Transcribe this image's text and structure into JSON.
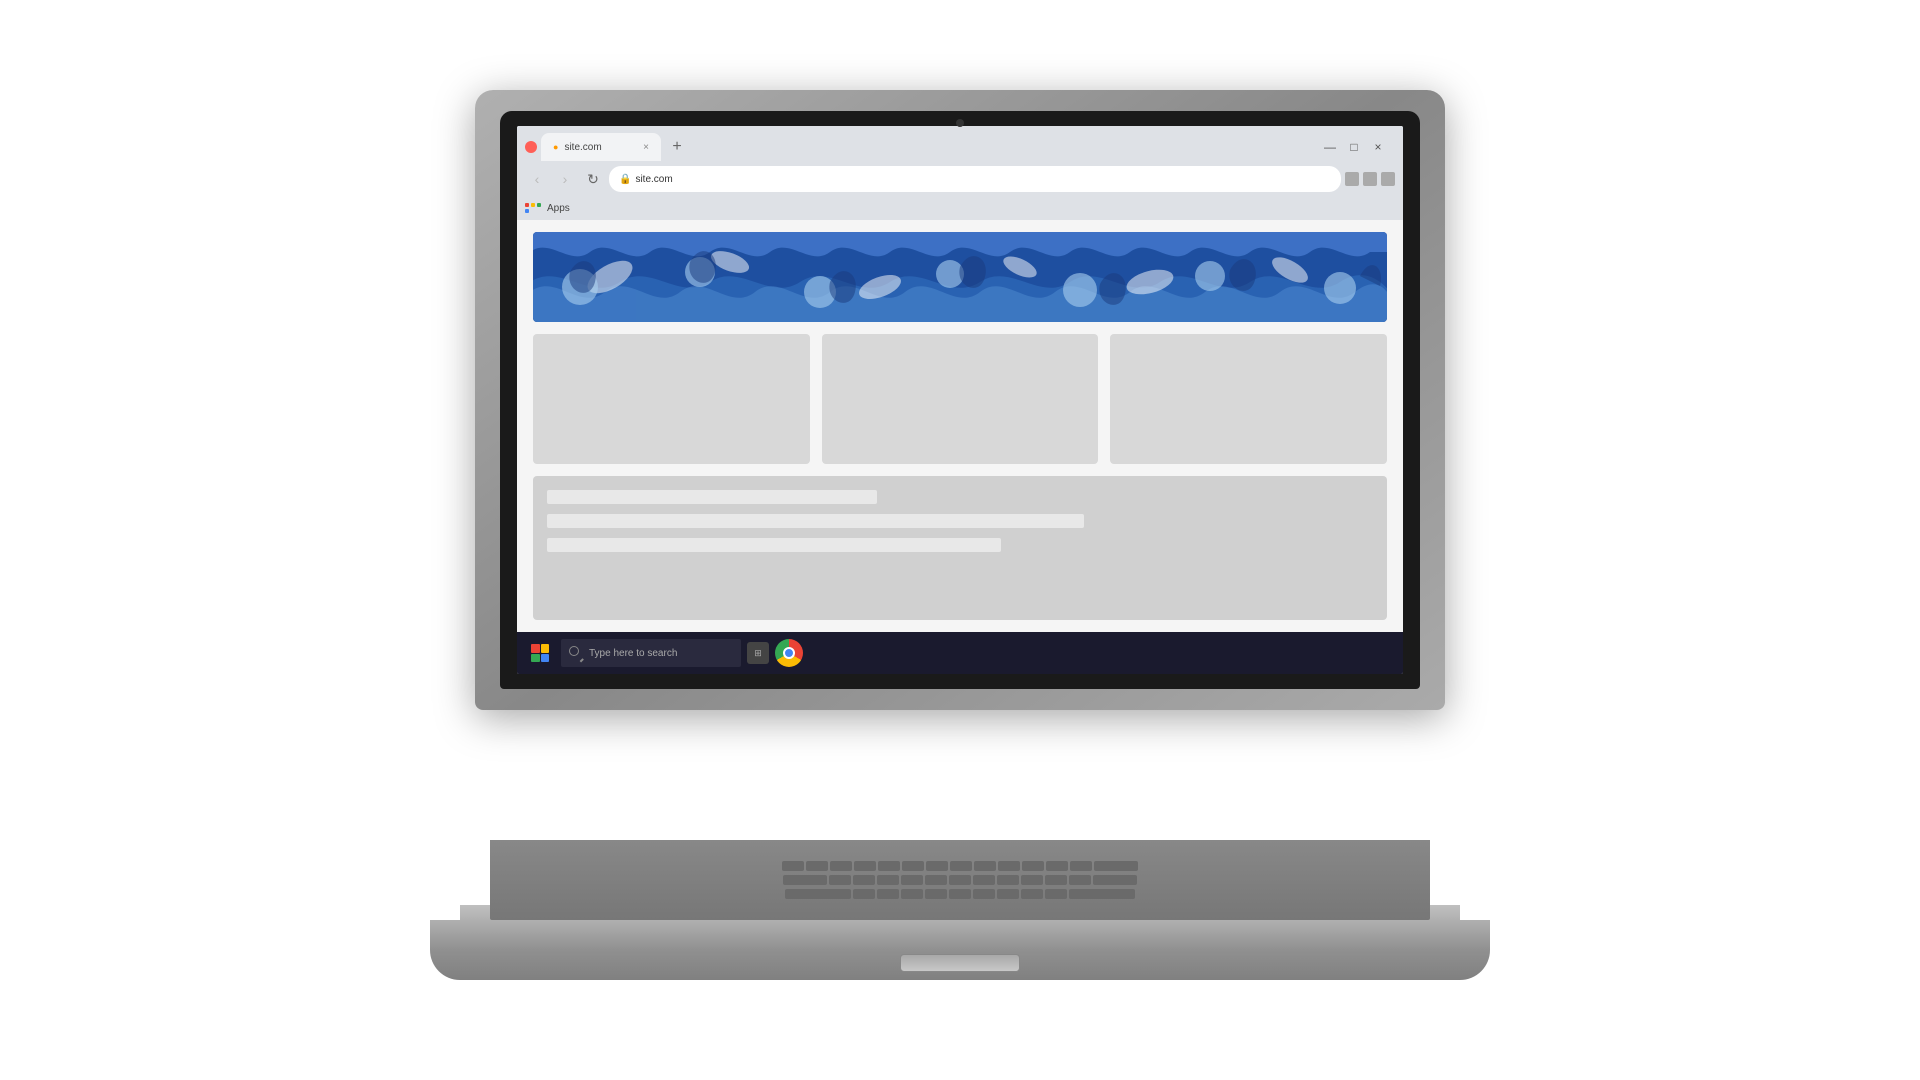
{
  "browser": {
    "tab_label": "site.com",
    "url": "site.com",
    "new_tab_symbol": "+",
    "nav": {
      "back": "‹",
      "forward": "›",
      "refresh": "↻"
    },
    "window_controls": {
      "minimize": "—",
      "maximize": "□",
      "close": "×"
    },
    "bookmarks": {
      "apps_label": "Apps"
    }
  },
  "page": {
    "banner_alt": "Decorative blue floral pattern banner",
    "card1_alt": "Content card 1",
    "card2_alt": "Content card 2",
    "card3_alt": "Content card 3",
    "text_line1_width": "40%",
    "text_line2_width": "65%",
    "text_line3_width": "55%"
  },
  "taskbar": {
    "search_placeholder": "Type here to search",
    "windows_icon_alt": "Windows Start button",
    "search_icon_alt": "Search icon",
    "chrome_icon_alt": "Google Chrome"
  },
  "apps_grid_colors": [
    "#ea4335",
    "#fbbc05",
    "#34a853",
    "#4285f4"
  ]
}
